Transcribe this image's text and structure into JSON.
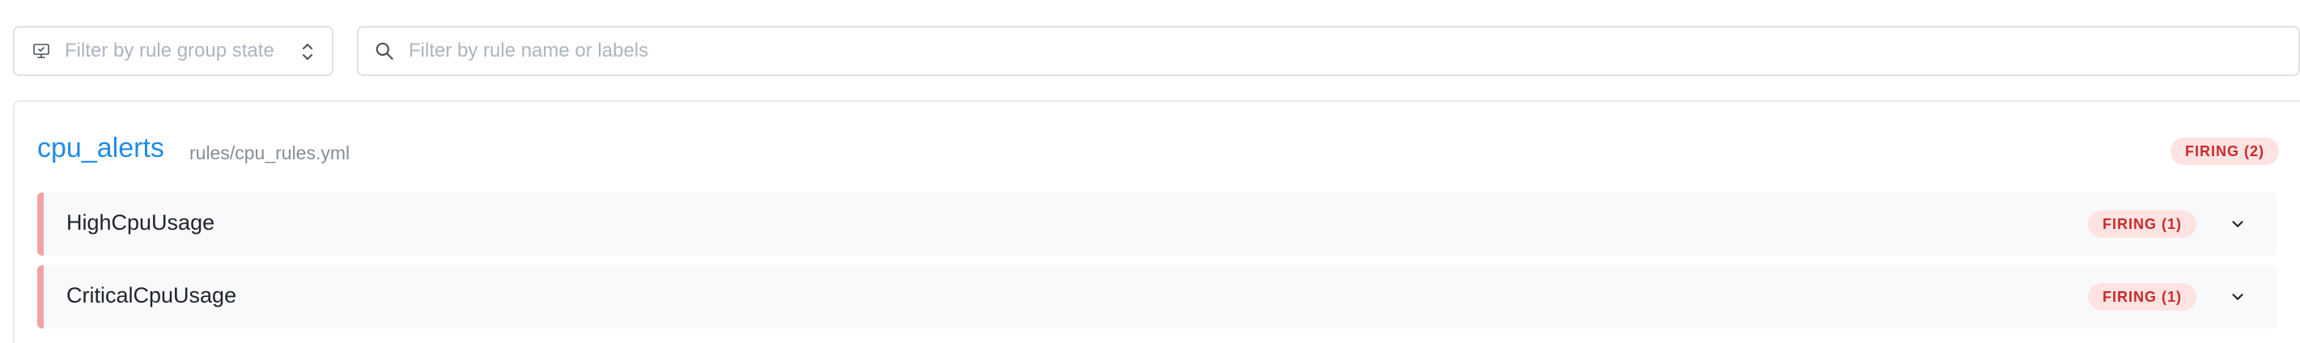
{
  "filters": {
    "state_placeholder": "Filter by rule group state",
    "search_placeholder": "Filter by rule name or labels",
    "state_icon": "monitor-icon",
    "chevrons_icon": "selector-chevrons-icon",
    "search_icon": "search-icon"
  },
  "group": {
    "name": "cpu_alerts",
    "file": "rules/cpu_rules.yml",
    "badge": "FIRING (2)",
    "rules": [
      {
        "name": "HighCpuUsage",
        "badge": "FIRING (1)"
      },
      {
        "name": "CriticalCpuUsage",
        "badge": "FIRING (1)"
      }
    ]
  },
  "colors": {
    "accent": "#228be6",
    "firing_bg": "#ffe3e3",
    "firing_text": "#c92a2a",
    "rule_accent": "#f1a3a3",
    "row_bg": "#f8f9fa"
  }
}
